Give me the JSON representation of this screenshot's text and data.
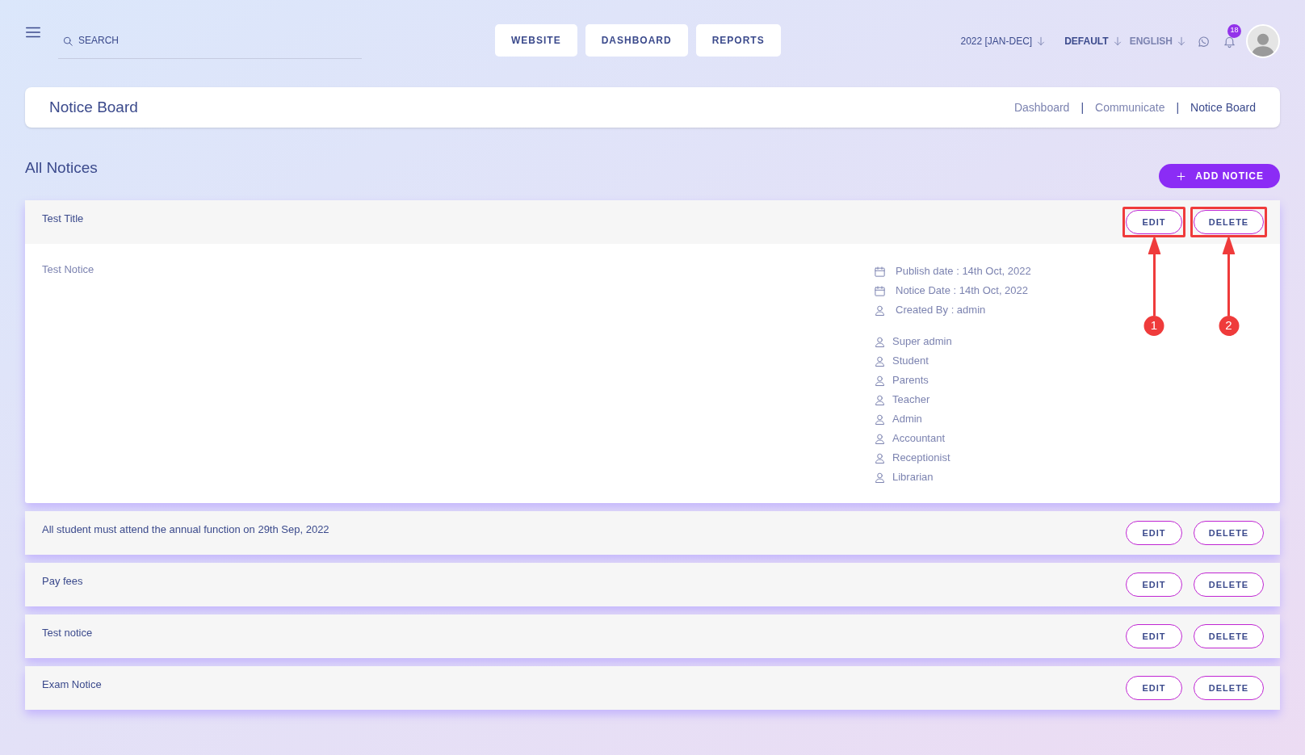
{
  "topbar": {
    "search_placeholder": "SEARCH",
    "nav_buttons": [
      "WEBSITE",
      "DASHBOARD",
      "REPORTS"
    ],
    "session": "2022 [JAN-DEC]",
    "theme": "DEFAULT",
    "language": "ENGLISH",
    "notification_count": "18"
  },
  "page_header": {
    "title": "Notice Board",
    "breadcrumbs": [
      "Dashboard",
      "Communicate",
      "Notice Board"
    ],
    "breadcrumb_separator": "|"
  },
  "section": {
    "title": "All Notices",
    "add_button": "ADD NOTICE"
  },
  "notices": [
    {
      "title": "Test Title",
      "expanded": true,
      "body": "Test Notice",
      "details": [
        {
          "kind": "date",
          "text": "Publish date : 14th Oct, 2022"
        },
        {
          "kind": "date",
          "text": "Notice Date : 14th Oct, 2022"
        },
        {
          "kind": "user",
          "text": "Created By : admin"
        }
      ],
      "audience": [
        "Super admin",
        "Student",
        "Parents",
        "Teacher",
        "Admin",
        "Accountant",
        "Receptionist",
        "Librarian"
      ],
      "edit_label": "EDIT",
      "delete_label": "DELETE",
      "edit_callout": "1",
      "delete_callout": "2"
    },
    {
      "title": "All student must attend the annual function on 29th Sep, 2022",
      "expanded": false,
      "edit_label": "EDIT",
      "delete_label": "DELETE"
    },
    {
      "title": "Pay fees",
      "expanded": false,
      "edit_label": "EDIT",
      "delete_label": "DELETE"
    },
    {
      "title": "Test notice",
      "expanded": false,
      "edit_label": "EDIT",
      "delete_label": "DELETE"
    },
    {
      "title": "Exam Notice",
      "expanded": false,
      "edit_label": "EDIT",
      "delete_label": "DELETE"
    }
  ]
}
